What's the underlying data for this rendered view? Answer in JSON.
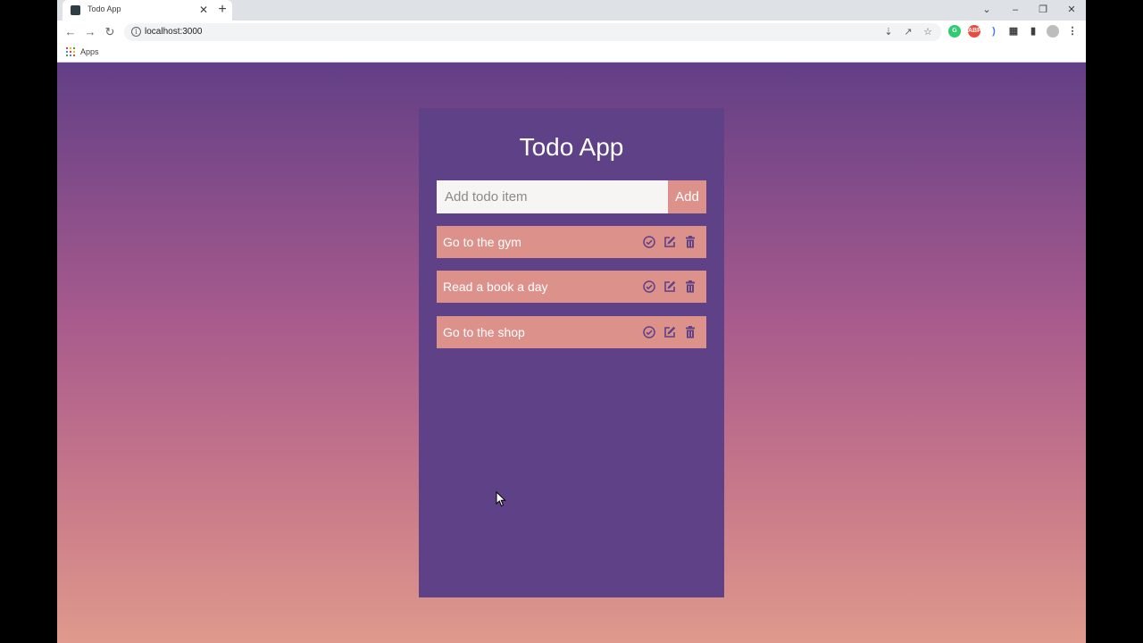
{
  "browser": {
    "tab_title": "Todo App",
    "tab_close": "✕",
    "new_tab": "+",
    "url": "localhost:3000",
    "bookmarks": {
      "apps_label": "Apps"
    },
    "controls": {
      "tab_search": "⌄",
      "minimize": "–",
      "restore": "❐",
      "close": "✕"
    }
  },
  "app": {
    "title": "Todo App",
    "input_placeholder": "Add todo item",
    "add_button_label": "Add",
    "todos": [
      {
        "text": "Go to the gym"
      },
      {
        "text": "Read a book a day"
      },
      {
        "text": "Go to the shop"
      }
    ]
  },
  "colors": {
    "card": "#5e4186",
    "accent": "#dd918b",
    "input_bg": "#f7f5f4"
  }
}
